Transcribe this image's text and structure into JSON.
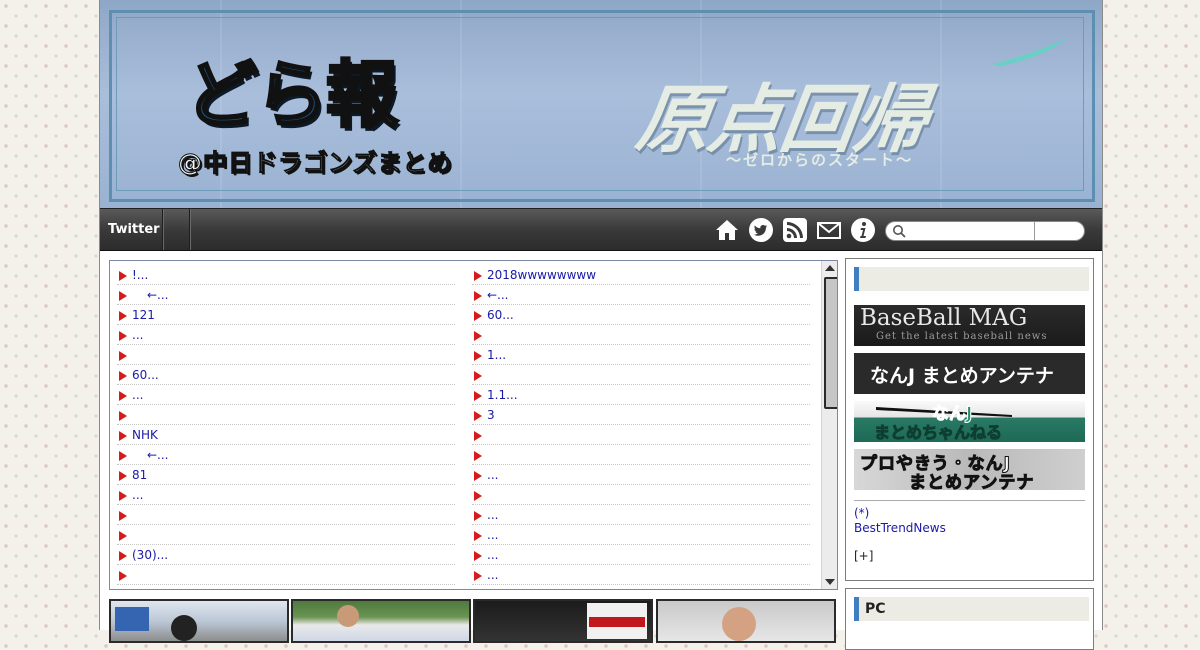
{
  "header": {
    "logo_text": "どら報",
    "logo_sub": "@中日ドラゴンズまとめ",
    "slogan": "原点回帰",
    "slogan_sub": "〜ゼロからのスタート〜"
  },
  "nav": {
    "twitter_label": "Twitter",
    "icons": [
      "home-icon",
      "twitter-icon",
      "rss-icon",
      "mail-icon",
      "info-icon"
    ],
    "search_placeholder": ""
  },
  "list": {
    "left": [
      {
        "text": "!...",
        "indent": false
      },
      {
        "text": "←...",
        "indent": true
      },
      {
        "text": "121",
        "indent": false
      },
      {
        "text": "...",
        "indent": false
      },
      {
        "text": "",
        "indent": false
      },
      {
        "text": "60...",
        "indent": false
      },
      {
        "text": "...",
        "indent": false
      },
      {
        "text": "",
        "indent": false
      },
      {
        "text": "NHK",
        "indent": false
      },
      {
        "text": "←...",
        "indent": true
      },
      {
        "text": "81",
        "indent": false
      },
      {
        "text": "...",
        "indent": false
      },
      {
        "text": "",
        "indent": false
      },
      {
        "text": "",
        "indent": false
      },
      {
        "text": "(30)...",
        "indent": false
      },
      {
        "text": "",
        "indent": false
      },
      {
        "text": "",
        "indent": false
      }
    ],
    "right": [
      {
        "text": "2018wwwwwwww",
        "indent": false
      },
      {
        "text": "←...",
        "indent": false
      },
      {
        "text": "60...",
        "indent": false
      },
      {
        "text": "",
        "indent": false
      },
      {
        "text": "1...",
        "indent": false
      },
      {
        "text": "",
        "indent": false
      },
      {
        "text": "1.1...",
        "indent": false
      },
      {
        "text": "3",
        "indent": false
      },
      {
        "text": "",
        "indent": false
      },
      {
        "text": "",
        "indent": false
      },
      {
        "text": "...",
        "indent": false
      },
      {
        "text": "",
        "indent": false
      },
      {
        "text": "...",
        "indent": false
      },
      {
        "text": "...",
        "indent": false
      },
      {
        "text": "...",
        "indent": false
      },
      {
        "text": "...",
        "indent": false
      },
      {
        "text": "",
        "indent": false
      }
    ]
  },
  "sidebar": {
    "box1_heading": "",
    "ads": {
      "ad1_title": "BaseBall MAG",
      "ad1_sub": "Get the latest baseball news",
      "ad2_title": "なんJ まとめアンテナ",
      "ad3_line1": "なんJ",
      "ad3_line2": "まとめちゃんねる",
      "ad4_line1": "プロやきう・なんJ",
      "ad4_line2": "まとめアンテナ"
    },
    "star_link": "(*)",
    "trend_link": "BestTrendNews",
    "plus_label": "[+]",
    "box2_heading": "PC"
  },
  "colors": {
    "link": "#1a1aa8",
    "bullet": "#d41c1c",
    "accent": "#3f7fbf"
  }
}
